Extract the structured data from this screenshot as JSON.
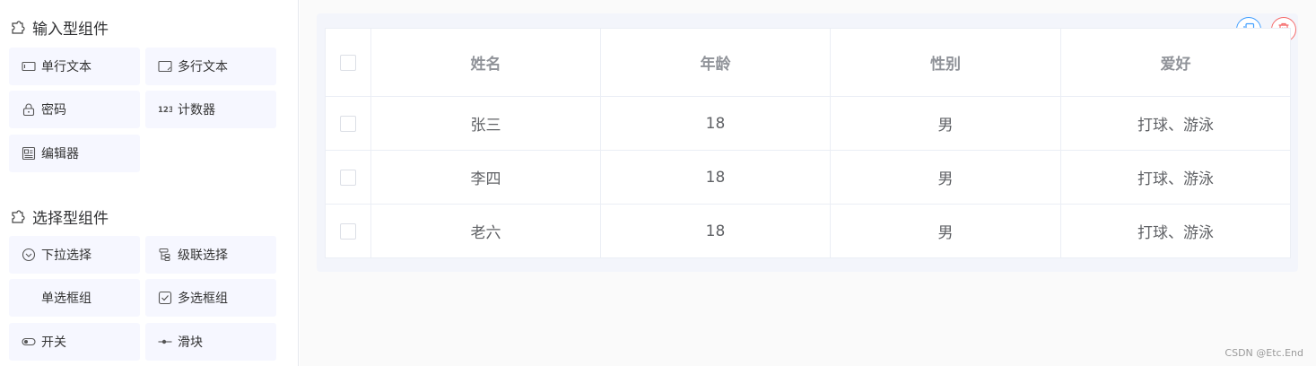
{
  "sidebar": {
    "groups": [
      {
        "title": "输入型组件",
        "icon": "component-icon",
        "items": [
          {
            "label": "单行文本",
            "icon": "input-icon"
          },
          {
            "label": "多行文本",
            "icon": "textarea-icon"
          },
          {
            "label": "密码",
            "icon": "lock-icon"
          },
          {
            "label": "计数器",
            "icon": "number-icon"
          },
          {
            "label": "编辑器",
            "icon": "editor-icon"
          }
        ]
      },
      {
        "title": "选择型组件",
        "icon": "component-icon",
        "items": [
          {
            "label": "下拉选择",
            "icon": "select-icon"
          },
          {
            "label": "级联选择",
            "icon": "cascader-icon"
          },
          {
            "label": "单选框组",
            "icon": "radio-icon"
          },
          {
            "label": "多选框组",
            "icon": "checkbox-icon"
          },
          {
            "label": "开关",
            "icon": "switch-icon"
          },
          {
            "label": "滑块",
            "icon": "slider-icon"
          }
        ]
      }
    ]
  },
  "canvas": {
    "actions": {
      "copy_icon": "copy-icon",
      "delete_icon": "trash-icon"
    },
    "table": {
      "columns": [
        "姓名",
        "年龄",
        "性别",
        "爱好"
      ],
      "rows": [
        {
          "name": "张三",
          "age": "18",
          "gender": "男",
          "hobby": "打球、游泳"
        },
        {
          "name": "李四",
          "age": "18",
          "gender": "男",
          "hobby": "打球、游泳"
        },
        {
          "name": "老六",
          "age": "18",
          "gender": "男",
          "hobby": "打球、游泳"
        }
      ]
    }
  },
  "watermark": "CSDN @Etc.End",
  "colors": {
    "primary": "#409eff",
    "danger": "#f56c6c",
    "item_bg": "#f6f7ff"
  }
}
